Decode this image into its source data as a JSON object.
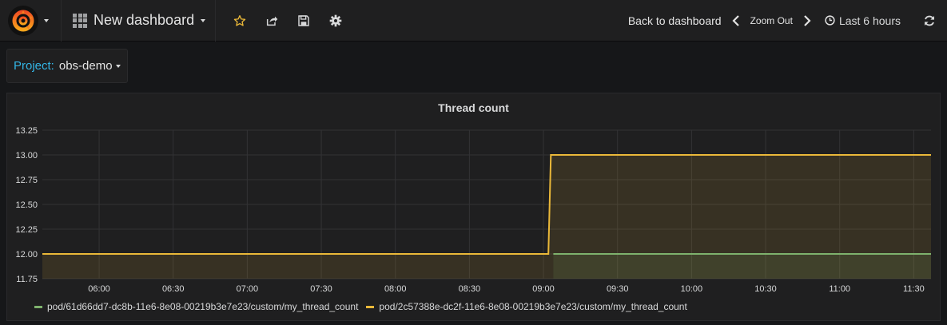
{
  "navbar": {
    "dashboard_title": "New dashboard",
    "back_label": "Back to dashboard",
    "zoom_out_label": "Zoom Out",
    "time_range_label": "Last 6 hours",
    "icons": [
      "grafana-logo",
      "grid-icon",
      "star-icon",
      "share-icon",
      "save-icon",
      "gear-icon",
      "chevron-left-icon",
      "chevron-right-icon",
      "clock-icon",
      "refresh-icon"
    ]
  },
  "template_var": {
    "label": "Project:",
    "value": "obs-demo"
  },
  "colors": {
    "green_series": "#7eb26d",
    "yellow_series": "#eab839",
    "label_accent": "#33b5e5",
    "star": "#eab839"
  },
  "chart_data": {
    "type": "line",
    "title": "Thread count",
    "xlabel": "",
    "ylabel": "",
    "x_ticks": [
      "06:00",
      "06:30",
      "07:00",
      "07:30",
      "08:00",
      "08:30",
      "09:00",
      "09:30",
      "10:00",
      "10:30",
      "11:00",
      "11:30"
    ],
    "x_range": [
      "05:37",
      "11:37"
    ],
    "y_ticks": [
      "11.75",
      "12.00",
      "12.25",
      "12.50",
      "12.75",
      "13.00",
      "13.25"
    ],
    "ylim": [
      11.75,
      13.25
    ],
    "grid": true,
    "legend_position": "bottom",
    "fill": true,
    "series": [
      {
        "name": "pod/61d66dd7-dc8b-11e6-8e08-00219b3e7e23/custom/my_thread_count",
        "color": "#7eb26d",
        "points": [
          [
            "09:04",
            12.0
          ],
          [
            "11:37",
            12.0
          ]
        ]
      },
      {
        "name": "pod/2c57388e-dc2f-11e6-8e08-00219b3e7e23/custom/my_thread_count",
        "color": "#eab839",
        "points": [
          [
            "05:37",
            12.0
          ],
          [
            "09:02",
            12.0
          ],
          [
            "09:03",
            13.0
          ],
          [
            "11:37",
            13.0
          ]
        ]
      }
    ]
  }
}
